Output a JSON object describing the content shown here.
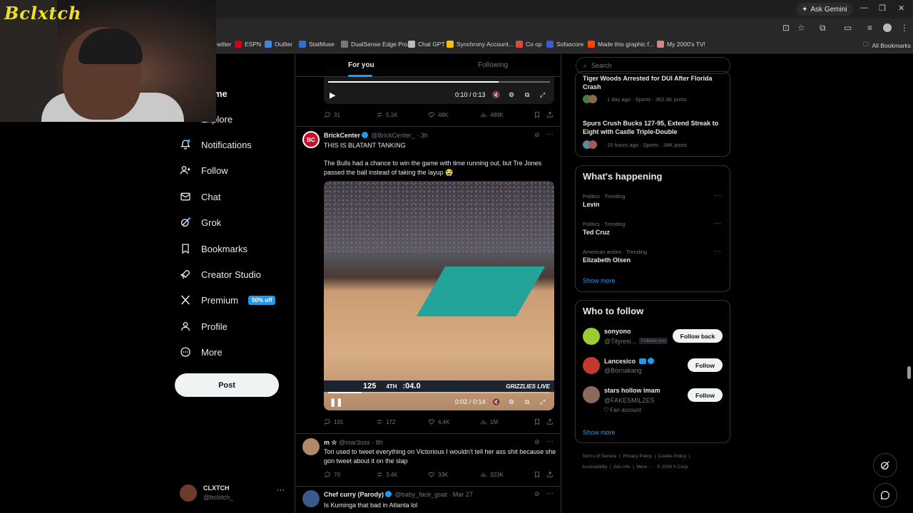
{
  "browser": {
    "ask_gemini": "Ask Gemini",
    "bookmarks": [
      {
        "label": "witter",
        "color": "#1d9bf0"
      },
      {
        "label": "ESPN",
        "color": "#d0021b"
      },
      {
        "label": "Outlier",
        "color": "#3a8bd8"
      },
      {
        "label": "StatMuse",
        "color": "#2a72d4"
      },
      {
        "label": "DualSense Edge Pro...",
        "color": "#777777"
      },
      {
        "label": "Chat GPT",
        "color": "#bbbbbb"
      },
      {
        "label": "Synchrony Account...",
        "color": "#f2c200"
      },
      {
        "label": "Co op",
        "color": "#d84a3a"
      },
      {
        "label": "Sofascore",
        "color": "#3c5bd6"
      },
      {
        "label": "Made this graphic f...",
        "color": "#ff4500"
      },
      {
        "label": "My 2000's TV!",
        "color": "#c88"
      }
    ],
    "all_bookmarks": "All Bookmarks"
  },
  "webcam": {
    "logo": "Bclxtch"
  },
  "nav": {
    "items": [
      {
        "label": "Home",
        "icon": "home-icon"
      },
      {
        "label": "Explore",
        "icon": "search-icon"
      },
      {
        "label": "Notifications",
        "icon": "bell-icon"
      },
      {
        "label": "Follow",
        "icon": "add-user-icon"
      },
      {
        "label": "Chat",
        "icon": "envelope-icon"
      },
      {
        "label": "Grok",
        "icon": "grok-icon"
      },
      {
        "label": "Bookmarks",
        "icon": "bookmark-icon"
      },
      {
        "label": "Creator Studio",
        "icon": "rocket-icon"
      },
      {
        "label": "Premium",
        "icon": "x-logo-icon",
        "badge": "50% off"
      },
      {
        "label": "Profile",
        "icon": "person-icon"
      },
      {
        "label": "More",
        "icon": "more-circle-icon"
      }
    ],
    "home_visible": "me",
    "explore_visible": "Explore",
    "post_button": "Post",
    "account": {
      "name": "CLXTCH",
      "handle": "@bclxtch_"
    }
  },
  "timeline": {
    "tabs": [
      "For you",
      "Following"
    ],
    "tweets": [
      {
        "video_time": "0:10 / 0:13",
        "video_progress": 0.77,
        "stats": {
          "replies": "31",
          "reposts": "5.1K",
          "likes": "48K",
          "views": "489K"
        }
      },
      {
        "name": "BrickCenter",
        "handle": "@BrickCenter_",
        "time": "3h",
        "avatar_text": "BC",
        "headline": "THIS IS BLATANT TANKING",
        "text": "The Bulls had a chance to win the game with time running out, but Tre Jones passed the ball instead of taking the layup 😭",
        "video_time": "0:02 / 0:14",
        "video_progress": 0.15,
        "scorebug": {
          "score": "125",
          "quarter": "4TH",
          "clock": ":04.0",
          "team": "GRIZZLIES LIVE"
        },
        "stats": {
          "replies": "191",
          "reposts": "172",
          "likes": "4.4K",
          "views": "1M"
        }
      },
      {
        "name": "m ☆",
        "handle": "@mar3uss",
        "time": "8h",
        "text": "Tori used to tweet everything on Victorious I wouldn't tell her ass shit because she gon tweet about it on the slap",
        "stats": {
          "replies": "70",
          "reposts": "3.4K",
          "likes": "33K",
          "views": "323K"
        }
      },
      {
        "name": "Chef curry (Parody)",
        "handle": "@baby_face_goat",
        "time": "Mar 27",
        "text": "Is Kuminga that bad in Atlanta lol"
      }
    ]
  },
  "right": {
    "search_placeholder": "Search",
    "news": [
      {
        "title": "Tiger Woods Arrested for DUI After Florida Crash",
        "meta": "1 day ago · Sports · 362.3K posts"
      },
      {
        "title": "Spurs Crush Bucks 127-95, Extend Streak to Eight with Castle Triple-Double",
        "meta": "15 hours ago · Sports · 34K posts"
      }
    ],
    "whats_happening": {
      "title": "What's happening",
      "trends": [
        {
          "category": "Politics · Trending",
          "name": "Levin"
        },
        {
          "category": "Politics · Trending",
          "name": "Ted Cruz"
        },
        {
          "category": "American actors · Trending",
          "name": "Elizabeth Olsen"
        }
      ],
      "show_more": "Show more"
    },
    "who_to_follow": {
      "title": "Who to follow",
      "accounts": [
        {
          "name": "sonyono",
          "handle": "@Tityresi...",
          "tag": "Follows you",
          "button": "Follow back",
          "color": "#9acd32"
        },
        {
          "name": "Lancesico",
          "handle": "@Bornakang",
          "button": "Follow",
          "color": "#c0392b"
        },
        {
          "name": "stars hollow imam",
          "handle": "@FAKESMILZES",
          "sub": "Fan account",
          "button": "Follow",
          "color": "#8a6a5a"
        }
      ],
      "show_more": "Show more"
    },
    "footer": [
      "Terms of Service",
      "Privacy Policy",
      "Cookie Policy",
      "Accessibility",
      "Ads info",
      "More ···",
      "© 2026 X Corp."
    ]
  }
}
